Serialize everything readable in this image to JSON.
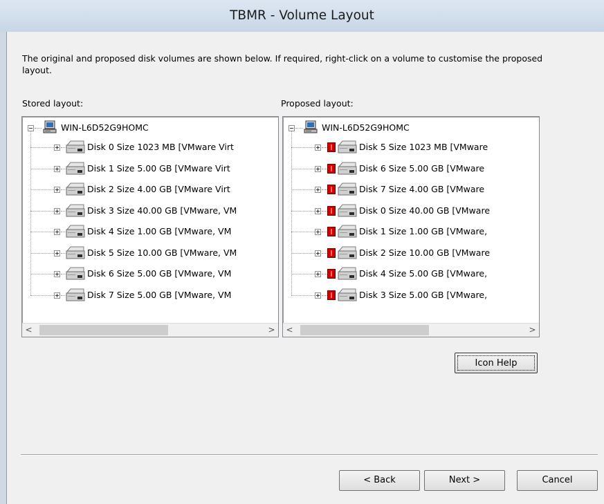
{
  "window": {
    "title": "TBMR - Volume Layout"
  },
  "intro": "The original and proposed disk volumes are shown below. If required, right-click on a volume to customise the proposed layout.",
  "stored": {
    "label": "Stored layout:",
    "root": "WIN-L6D52G9HOMC",
    "disks": [
      "Disk 0 Size 1023 MB [VMware Virt",
      "Disk 1 Size  5.00 GB [VMware Virt",
      "Disk 2 Size  4.00 GB [VMware Virt",
      "Disk 3 Size 40.00 GB [VMware, VM",
      "Disk 4 Size  1.00 GB [VMware, VM",
      "Disk 5 Size 10.00 GB [VMware, VM",
      "Disk 6 Size  5.00 GB [VMware, VM",
      "Disk 7 Size  5.00 GB [VMware, VM"
    ]
  },
  "proposed": {
    "label": "Proposed layout:",
    "root": "WIN-L6D52G9HOMC",
    "disks": [
      "Disk 5 Size 1023 MB [VMware ",
      "Disk 6 Size  5.00 GB [VMware ",
      "Disk 7 Size  4.00 GB [VMware ",
      "Disk 0 Size 40.00 GB [VMware",
      "Disk 1 Size  1.00 GB [VMware,",
      "Disk 2 Size 10.00 GB [VMware",
      "Disk 4 Size  5.00 GB [VMware,",
      "Disk 3 Size  5.00 GB [VMware,"
    ]
  },
  "scroll": {
    "left": "<",
    "right": ">"
  },
  "buttons": {
    "icon_help": "Icon Help",
    "back": "< Back",
    "next": "Next >",
    "cancel": "Cancel"
  },
  "icons": {
    "computer": "computer-icon",
    "disk": "hard-disk-icon",
    "warning": "red-warning-icon"
  }
}
